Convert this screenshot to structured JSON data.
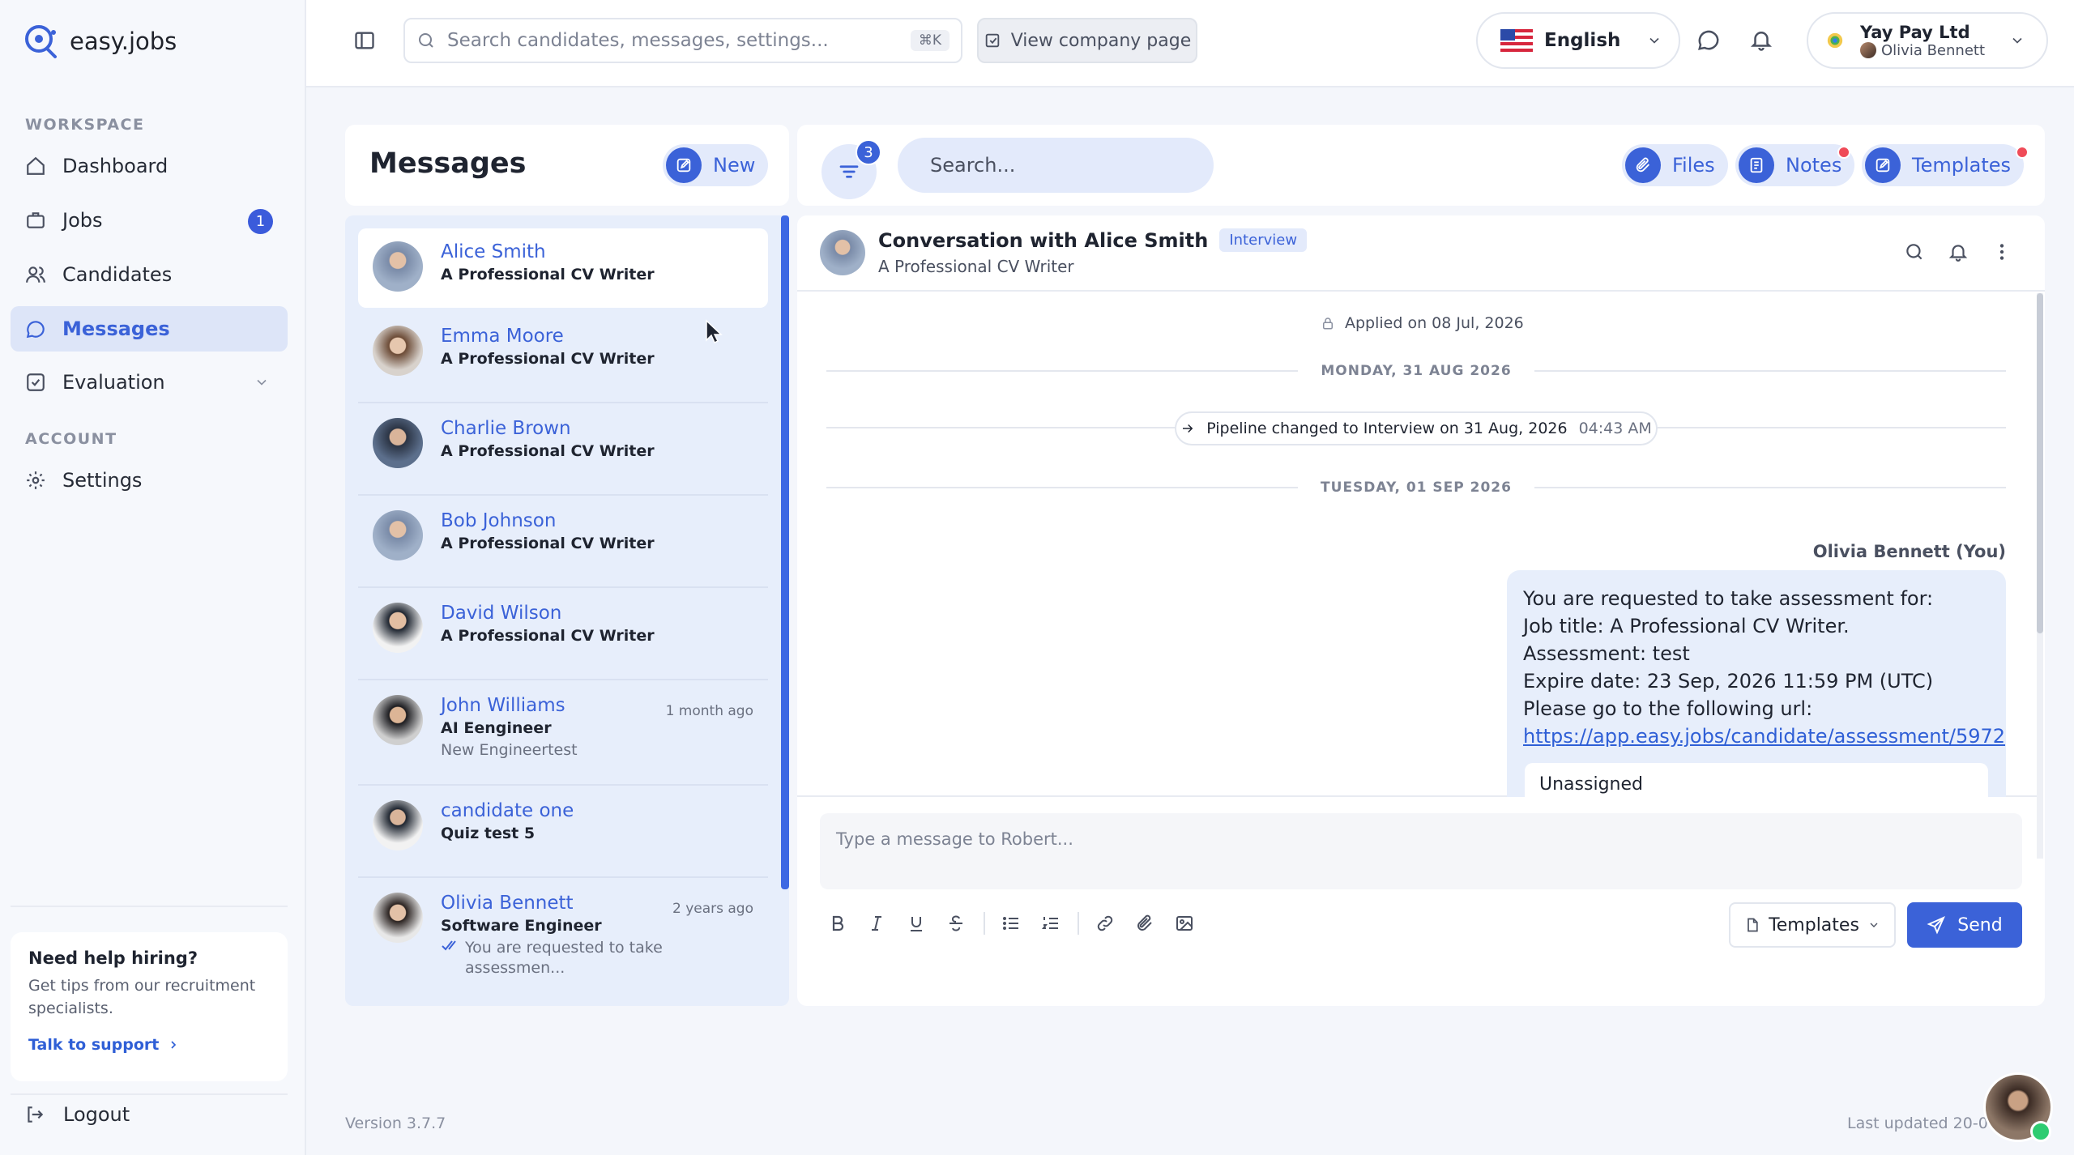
{
  "app": {
    "name": "easy.jobs"
  },
  "sidebar": {
    "workspace_label": "WORKSPACE",
    "account_label": "ACCOUNT",
    "items": [
      {
        "label": "Dashboard",
        "icon": "home-icon"
      },
      {
        "label": "Jobs",
        "icon": "briefcase-icon",
        "badge": "1"
      },
      {
        "label": "Candidates",
        "icon": "users-icon"
      },
      {
        "label": "Messages",
        "icon": "message-icon",
        "active": true
      },
      {
        "label": "Evaluation",
        "icon": "checkbox-icon"
      },
      {
        "label": "Settings",
        "icon": "gear-icon"
      }
    ],
    "help": {
      "title": "Need help hiring?",
      "text": "Get tips from our recruitment specialists.",
      "link": "Talk to support"
    },
    "logout": "Logout"
  },
  "topbar": {
    "search_placeholder": "Search candidates, messages, settings...",
    "shortcut": "⌘K",
    "view_company": "View company page",
    "language": "English",
    "company_name": "Yay Pay Ltd",
    "user_name": "Olivia Bennett"
  },
  "messages": {
    "title": "Messages",
    "new_label": "New",
    "filter_count": "3",
    "search_placeholder": "Search...",
    "files_label": "Files",
    "notes_label": "Notes",
    "templates_label": "Templates"
  },
  "conversations": [
    {
      "name": "Alice Smith",
      "role": "A Professional CV Writer",
      "sub": "",
      "time": ""
    },
    {
      "name": "Emma Moore",
      "role": "A Professional CV Writer",
      "sub": "",
      "time": ""
    },
    {
      "name": "Charlie Brown",
      "role": "A Professional CV Writer",
      "sub": "",
      "time": ""
    },
    {
      "name": "Bob Johnson",
      "role": "A Professional CV Writer",
      "sub": "",
      "time": ""
    },
    {
      "name": "David Wilson",
      "role": "A Professional CV Writer",
      "sub": "",
      "time": ""
    },
    {
      "name": "John Williams",
      "role": "AI Eengineer",
      "sub": "New Engineertest",
      "time": "1 month ago"
    },
    {
      "name": "candidate one",
      "role": "Quiz test 5",
      "sub": "",
      "time": ""
    },
    {
      "name": "Olivia Bennett",
      "role": "Software Engineer",
      "sub": "You are requested to take assessmen...",
      "time": "2 years ago"
    }
  ],
  "chat": {
    "title": "Conversation with Alice Smith",
    "tag": "Interview",
    "subtitle": "A Professional CV Writer",
    "applied": "Applied on 08 Jul, 2026",
    "date1": "MONDAY, 31 AUG 2026",
    "pipeline": "Pipeline changed to Interview on 31 Aug, 2026",
    "pipeline_time": "04:43 AM",
    "date2": "TUESDAY, 01 SEP 2026",
    "sender": "Olivia Bennett (You)",
    "message_lines": [
      "You are requested to take assessment for:",
      "Job title: A Professional CV Writer.",
      "Assessment: test",
      "Expire date: 23 Sep, 2026 11:59 PM (UTC)",
      "Please go to the following url:"
    ],
    "message_link": "https://app.easy.jobs/candidate/assessment/5972",
    "card_text": "Unassigned",
    "composer_placeholder": "Type a message to Robert...",
    "templates_label": "Templates",
    "send_label": "Send"
  },
  "footer": {
    "version": "Version 3.7.7",
    "last_updated": "Last updated 20-0"
  },
  "colors": {
    "accent": "#3b62d8",
    "badge": "#3b5bdb",
    "notify": "#ef4b58"
  }
}
